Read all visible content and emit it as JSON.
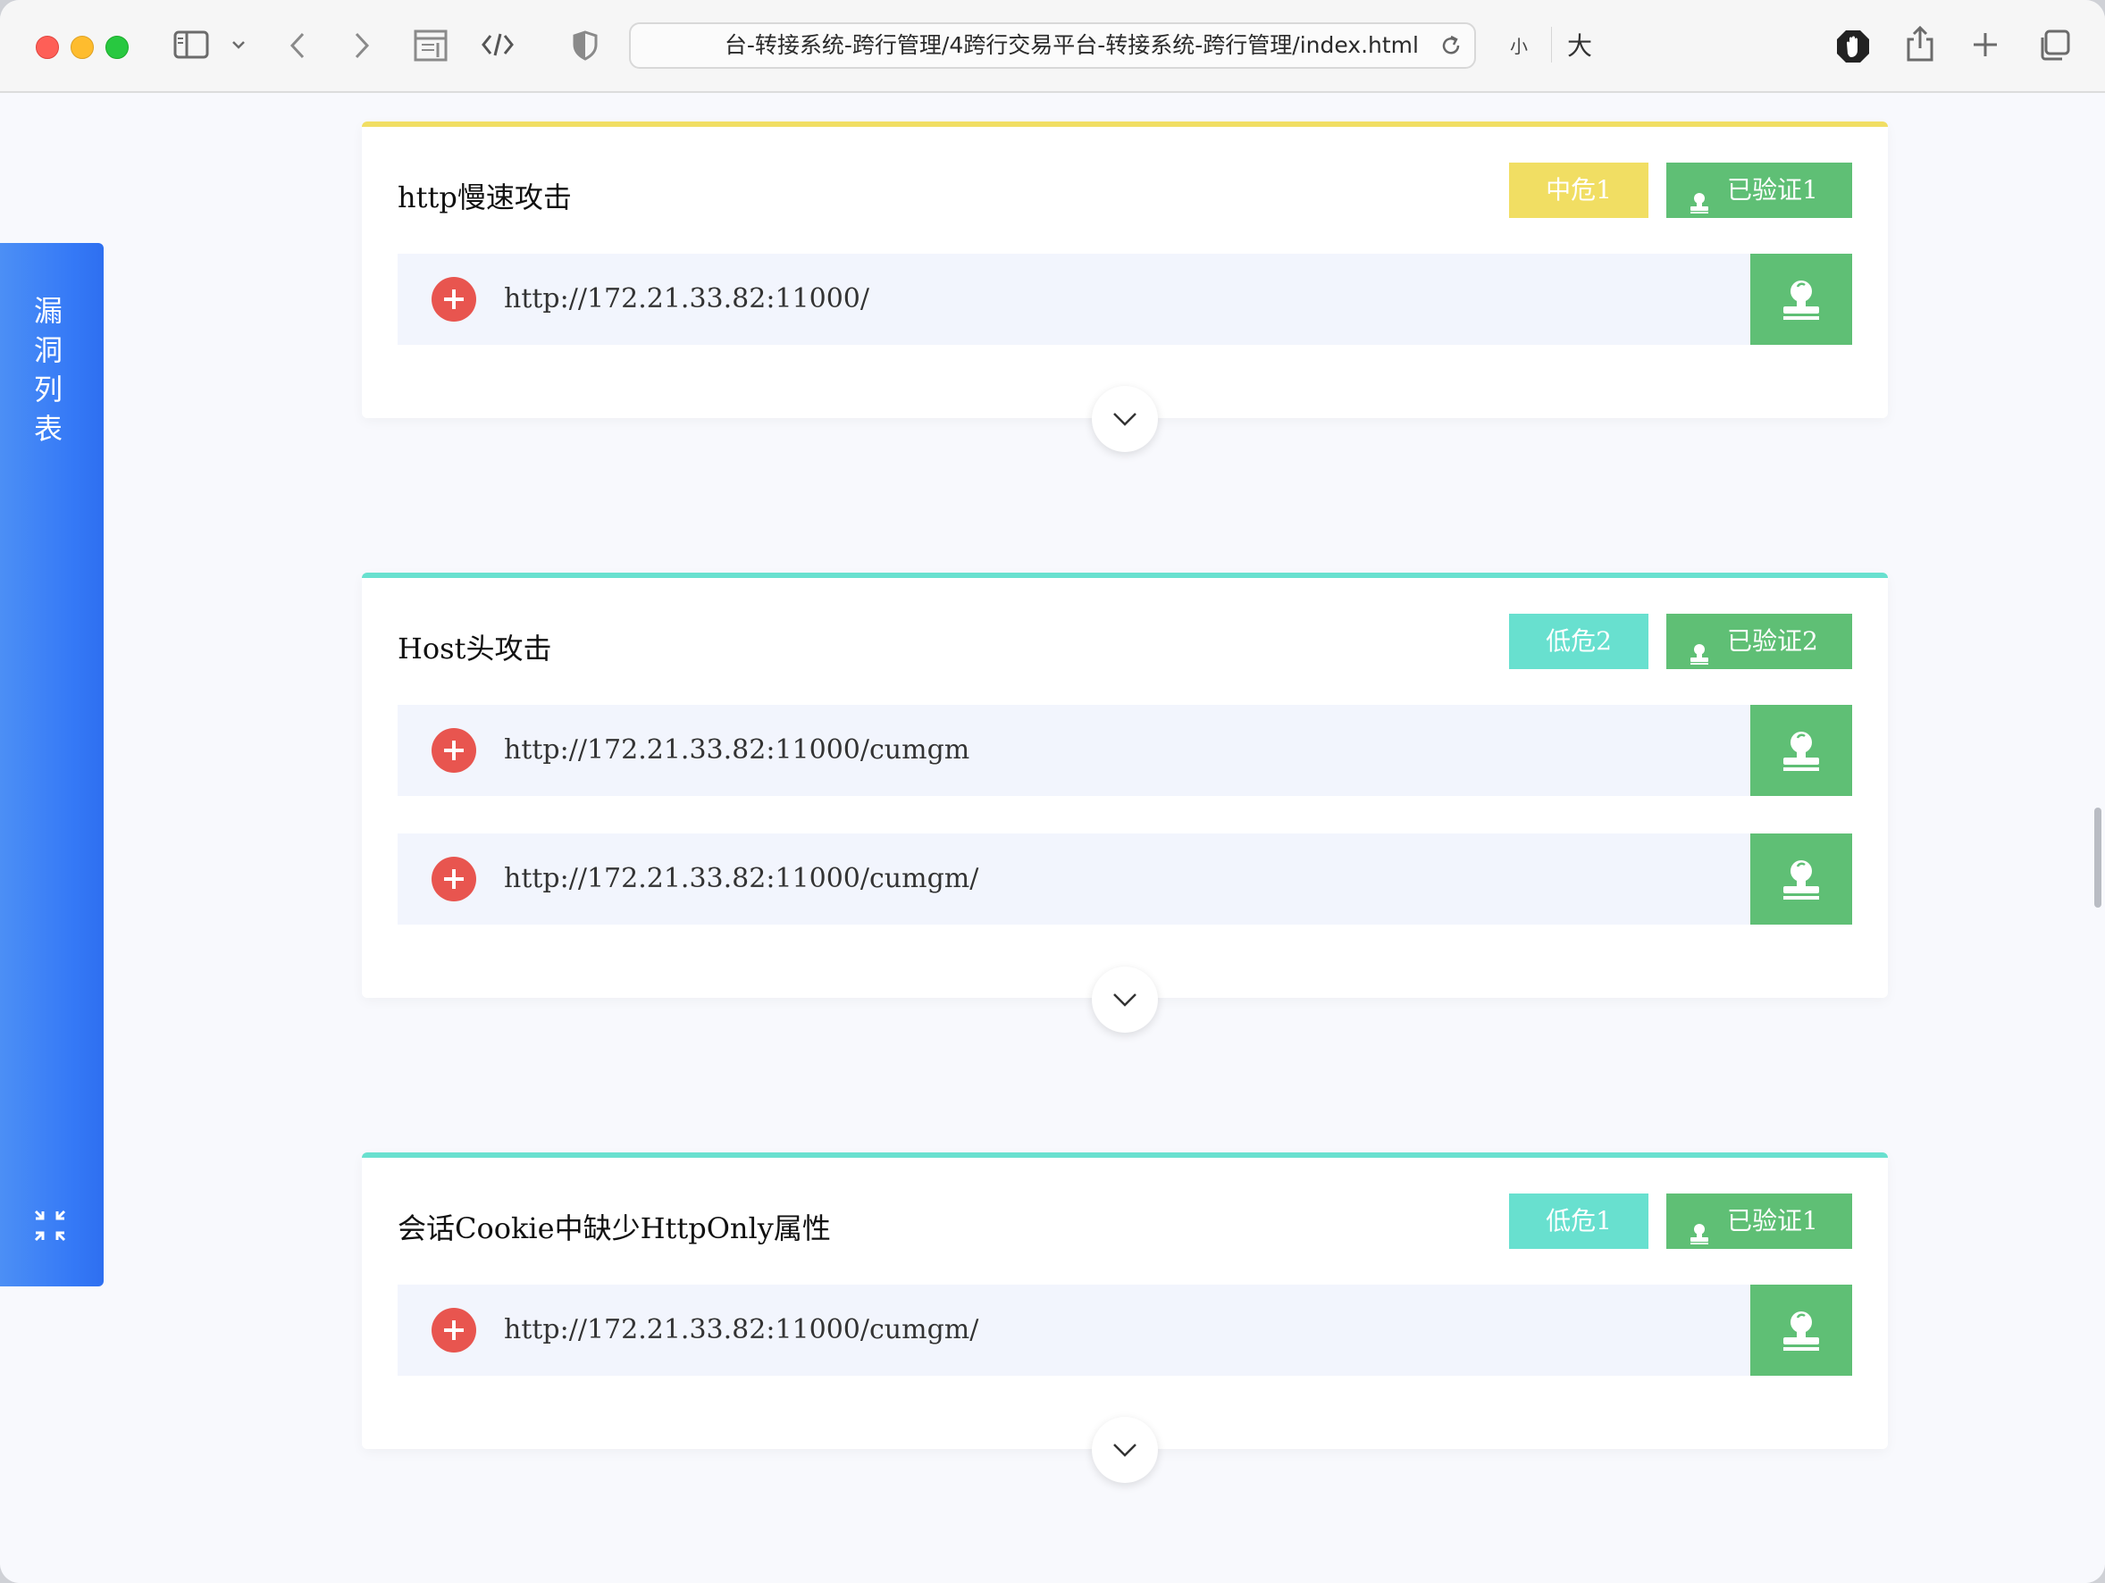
{
  "browser": {
    "address_url": "台-转接系统-跨行管理/4跨行交易平台-转接系统-跨行管理/index.html",
    "font_small_label": "小",
    "font_large_label": "大",
    "icons": [
      "sidebar-icon",
      "chevron-down-icon",
      "back-icon",
      "forward-icon",
      "reader-icon",
      "code-icon",
      "shield-icon",
      "reload-icon",
      "hand-icon",
      "share-icon",
      "new-tab-icon",
      "tabs-icon"
    ]
  },
  "side_panel": {
    "title_chars": [
      "漏",
      "洞",
      "列",
      "表"
    ],
    "collapse_icon": "collapse-icon",
    "color": "#3579f6"
  },
  "cards": [
    {
      "title": "http慢速攻击",
      "severity_label": "中危1",
      "severity_color": "#f1de63",
      "verified_label": "已验证1",
      "urls": [
        "http://172.21.33.82:11000/"
      ]
    },
    {
      "title": "Host头攻击",
      "severity_label": "低危2",
      "severity_color": "#68e0cf",
      "verified_label": "已验证2",
      "urls": [
        "http://172.21.33.82:11000/cumgm",
        "http://172.21.33.82:11000/cumgm/"
      ]
    },
    {
      "title": "会话Cookie中缺少HttpOnly属性",
      "severity_label": "低危1",
      "severity_color": "#68e0cf",
      "verified_label": "已验证1",
      "urls": [
        "http://172.21.33.82:11000/cumgm/"
      ]
    }
  ],
  "colors": {
    "verified_green": "#5fbf75",
    "add_red": "#e8554f",
    "row_bg": "#f2f5fd"
  }
}
